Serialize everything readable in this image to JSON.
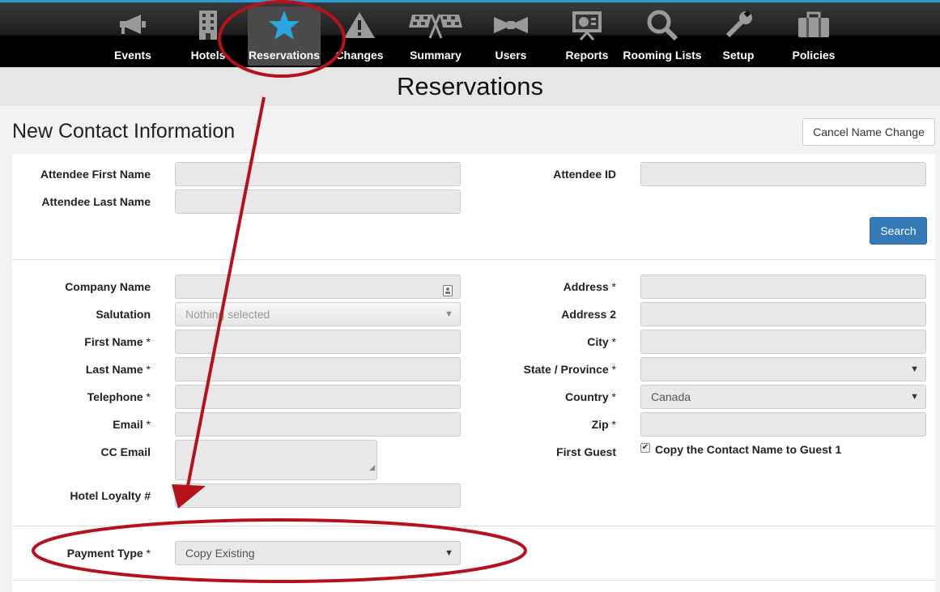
{
  "nav": {
    "items": [
      {
        "label": "Events",
        "icon": "megaphone-icon"
      },
      {
        "label": "Hotels",
        "icon": "building-icon"
      },
      {
        "label": "Reservations",
        "icon": "star-icon",
        "active": true
      },
      {
        "label": "Changes",
        "icon": "warning-icon"
      },
      {
        "label": "Summary",
        "icon": "checkered-flags-icon"
      },
      {
        "label": "Users",
        "icon": "bowtie-icon"
      },
      {
        "label": "Reports",
        "icon": "presentation-board-icon"
      },
      {
        "label": "Rooming Lists",
        "icon": "magnifier-icon"
      },
      {
        "label": "Setup",
        "icon": "wrench-icon"
      },
      {
        "label": "Policies",
        "icon": "briefcase-icon"
      }
    ],
    "accent_color": "#2a9fd6"
  },
  "page_title": "Reservations",
  "section_title": "New Contact Information",
  "cancel_button": "Cancel Name Change",
  "lookup": {
    "attendee_first_name": "Attendee First Name",
    "attendee_last_name": "Attendee Last Name",
    "attendee_id": "Attendee ID",
    "search_button": "Search"
  },
  "form": {
    "company_name": "Company Name",
    "salutation": "Salutation",
    "salutation_placeholder": "Nothing selected",
    "first_name": "First Name",
    "last_name": "Last Name",
    "telephone": "Telephone",
    "email": "Email",
    "cc_email": "CC Email",
    "hotel_loyalty": "Hotel Loyalty #",
    "address": "Address",
    "address2": "Address 2",
    "city": "City",
    "state": "State / Province",
    "country": "Country",
    "country_value": "Canada",
    "zip": "Zip",
    "first_guest": "First Guest",
    "copy_contact": "Copy the Contact Name to Guest 1",
    "required_mark": "*"
  },
  "payment": {
    "label": "Payment Type",
    "value": "Copy Existing"
  },
  "annotation_color": "#b5121b"
}
